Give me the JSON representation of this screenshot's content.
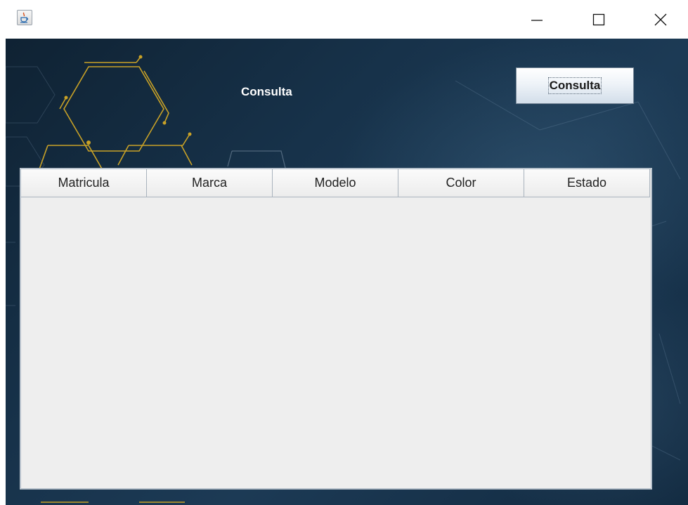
{
  "window": {
    "icon": "java-cup-icon",
    "controls": {
      "minimize": "minimize-icon",
      "maximize": "maximize-icon",
      "close": "close-icon"
    }
  },
  "main": {
    "heading": "Consulta",
    "button_label": "Consulta"
  },
  "table": {
    "columns": [
      "Matricula",
      "Marca",
      "Modelo",
      "Color",
      "Estado"
    ],
    "rows": []
  },
  "colors": {
    "background": "#17324a",
    "circuit": "#c9a227",
    "table_bg": "#eeeeee"
  }
}
